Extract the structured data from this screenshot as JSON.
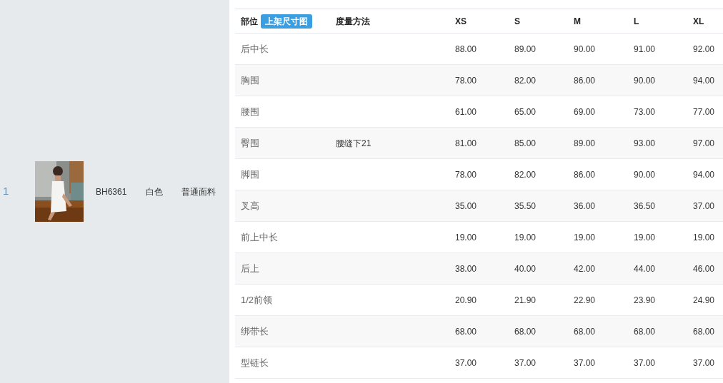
{
  "product": {
    "index": "1",
    "code": "BH6361",
    "color_name": "白色",
    "fabric": "普通面料"
  },
  "table": {
    "columns": {
      "part": "部位",
      "size_chart_badge": "上架尺寸图",
      "method": "度量方法",
      "sizes": [
        "XS",
        "S",
        "M",
        "L",
        "XL"
      ]
    },
    "rows": [
      {
        "part": "后中长",
        "values": [
          "88.00",
          "89.00",
          "90.00",
          "91.00",
          "92.00"
        ]
      },
      {
        "part": "胸围",
        "values": [
          "78.00",
          "82.00",
          "86.00",
          "90.00",
          "94.00"
        ]
      },
      {
        "part": "腰围",
        "values": [
          "61.00",
          "65.00",
          "69.00",
          "73.00",
          "77.00"
        ]
      },
      {
        "part": "臀围",
        "method": "腰缝下21",
        "values": [
          "81.00",
          "85.00",
          "89.00",
          "93.00",
          "97.00"
        ]
      },
      {
        "part": "脚围",
        "values": [
          "78.00",
          "82.00",
          "86.00",
          "90.00",
          "94.00"
        ]
      },
      {
        "part": "叉高",
        "values": [
          "35.00",
          "35.50",
          "36.00",
          "36.50",
          "37.00"
        ]
      },
      {
        "part": "前上中长",
        "values": [
          "19.00",
          "19.00",
          "19.00",
          "19.00",
          "19.00"
        ]
      },
      {
        "part": "后上",
        "values": [
          "38.00",
          "40.00",
          "42.00",
          "44.00",
          "46.00"
        ]
      },
      {
        "part": "1/2前领",
        "values": [
          "20.90",
          "21.90",
          "22.90",
          "23.90",
          "24.90"
        ]
      },
      {
        "part": "绑带长",
        "values": [
          "68.00",
          "68.00",
          "68.00",
          "68.00",
          "68.00"
        ]
      },
      {
        "part": "型链长",
        "values": [
          "37.00",
          "37.00",
          "37.00",
          "37.00",
          "37.00"
        ]
      }
    ]
  }
}
